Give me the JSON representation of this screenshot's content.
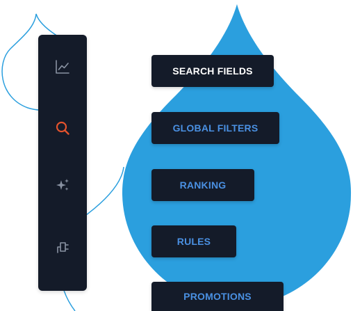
{
  "colors": {
    "panel_bg": "#141b29",
    "accent_blue": "#4a90e2",
    "drop_blue": "#2b9fde",
    "search_active": "#e4532d",
    "icon_gray": "#8a93a3",
    "active_text": "#ffffff"
  },
  "sidebar": {
    "items": [
      {
        "icon": "chart-line-icon",
        "active": false
      },
      {
        "icon": "search-icon",
        "active": true
      },
      {
        "icon": "sparkles-icon",
        "active": false
      },
      {
        "icon": "plug-icon",
        "active": false
      }
    ]
  },
  "menu": {
    "search_fields": "SEARCH FIELDS",
    "global_filters": "GLOBAL FILTERS",
    "ranking": "RANKING",
    "rules": "RULES",
    "promotions": "PROMOTIONS",
    "active": "search_fields"
  }
}
